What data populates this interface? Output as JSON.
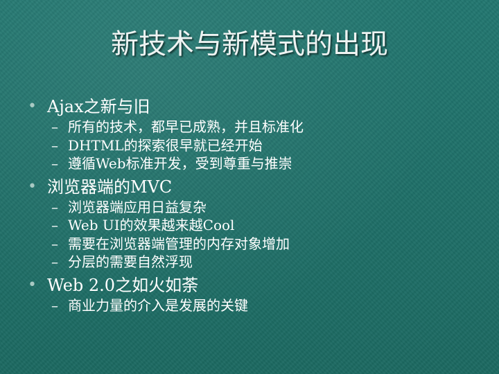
{
  "slide": {
    "title": "新技术与新模式的出现",
    "bullet_symbol": "•",
    "dash_symbol": "–",
    "items": [
      {
        "text": "Ajax之新与旧",
        "subitems": [
          "所有的技术，都早已成熟，并且标准化",
          "DHTML的探索很早就已经开始",
          "遵循Web标准开发，受到尊重与推崇"
        ]
      },
      {
        "text": "浏览器端的MVC",
        "subitems": [
          "浏览器端应用日益复杂",
          "Web UI的效果越来越Cool",
          "需要在浏览器端管理的内存对象增加",
          "分层的需要自然浮现"
        ]
      },
      {
        "text": "Web 2.0之如火如荼",
        "subitems": [
          "商业力量的介入是发展的关键"
        ]
      }
    ]
  },
  "colors": {
    "background": "#1f6f67",
    "bullet": "#a9c9c3",
    "text": "#ffffff"
  }
}
